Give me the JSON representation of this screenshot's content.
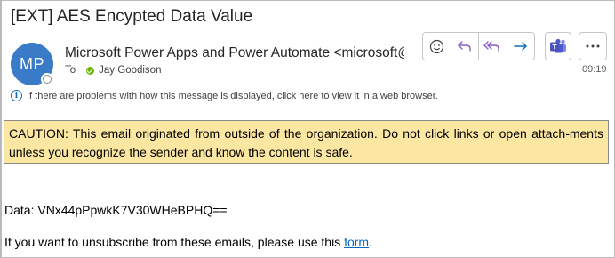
{
  "email": {
    "subject": "[EXT] AES Encypted Data Value",
    "avatar_initials": "MP",
    "sender": "Microsoft Power Apps and Power Automate <microsoft@",
    "to_label": "To",
    "recipient": "Jay Goodison",
    "time": "09:19",
    "info_text": "If there are problems with how this message is displayed, click here to view it in a web browser.",
    "caution_text": "CAUTION: This email originated from outside of the organization. Do not click links or open attach-ments unless you recognize the sender and know the content is safe.",
    "data_line": "Data: VNx44pPpwkK7V30WHeBPHQ==",
    "unsubscribe_prefix": "If you want to unsubscribe from these emails, please use this ",
    "unsubscribe_link": "form",
    "unsubscribe_suffix": "."
  },
  "toolbar": {
    "icons": [
      "emoji-icon",
      "reply-icon",
      "reply-all-icon",
      "forward-icon",
      "teams-icon",
      "more-icon"
    ]
  },
  "colors": {
    "avatar_bg": "#3a7bc8",
    "caution_bg": "#fbe6a2",
    "action_purple": "#8a5ec8",
    "link": "#0563c1",
    "presence_green": "#6bb700"
  }
}
